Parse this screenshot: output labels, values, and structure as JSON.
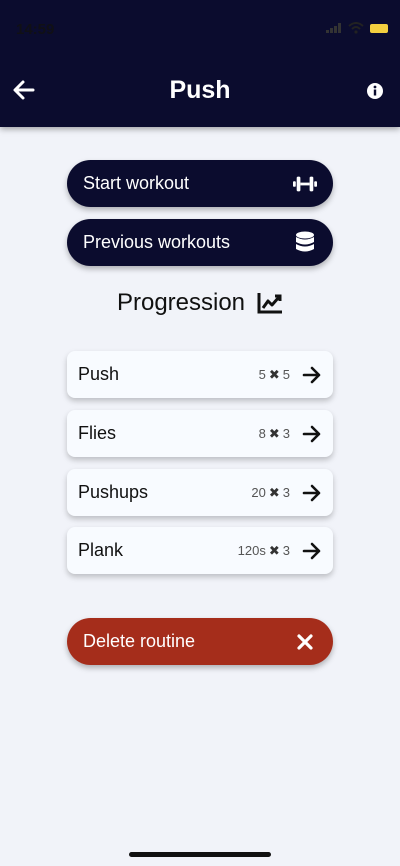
{
  "status": {
    "time": "14:59"
  },
  "header": {
    "title": "Push"
  },
  "actions": {
    "start_label": "Start workout",
    "previous_label": "Previous workouts",
    "delete_label": "Delete routine"
  },
  "progression": {
    "label": "Progression"
  },
  "exercises": [
    {
      "name": "Push",
      "reps": "5",
      "sets": "5"
    },
    {
      "name": "Flies",
      "reps": "8",
      "sets": "3"
    },
    {
      "name": "Pushups",
      "reps": "20",
      "sets": "3"
    },
    {
      "name": "Plank",
      "reps": "120s",
      "sets": "3"
    }
  ],
  "colors": {
    "header": "#0b0c2e",
    "background": "#f1f3f9",
    "delete": "#a52d1b"
  },
  "icons": {
    "back": "arrow-left-icon",
    "info": "info-icon",
    "start": "dumbbell-icon",
    "previous": "database-icon",
    "progression": "chart-line-icon",
    "exercise_arrow": "arrow-right-icon",
    "delete": "close-icon"
  }
}
